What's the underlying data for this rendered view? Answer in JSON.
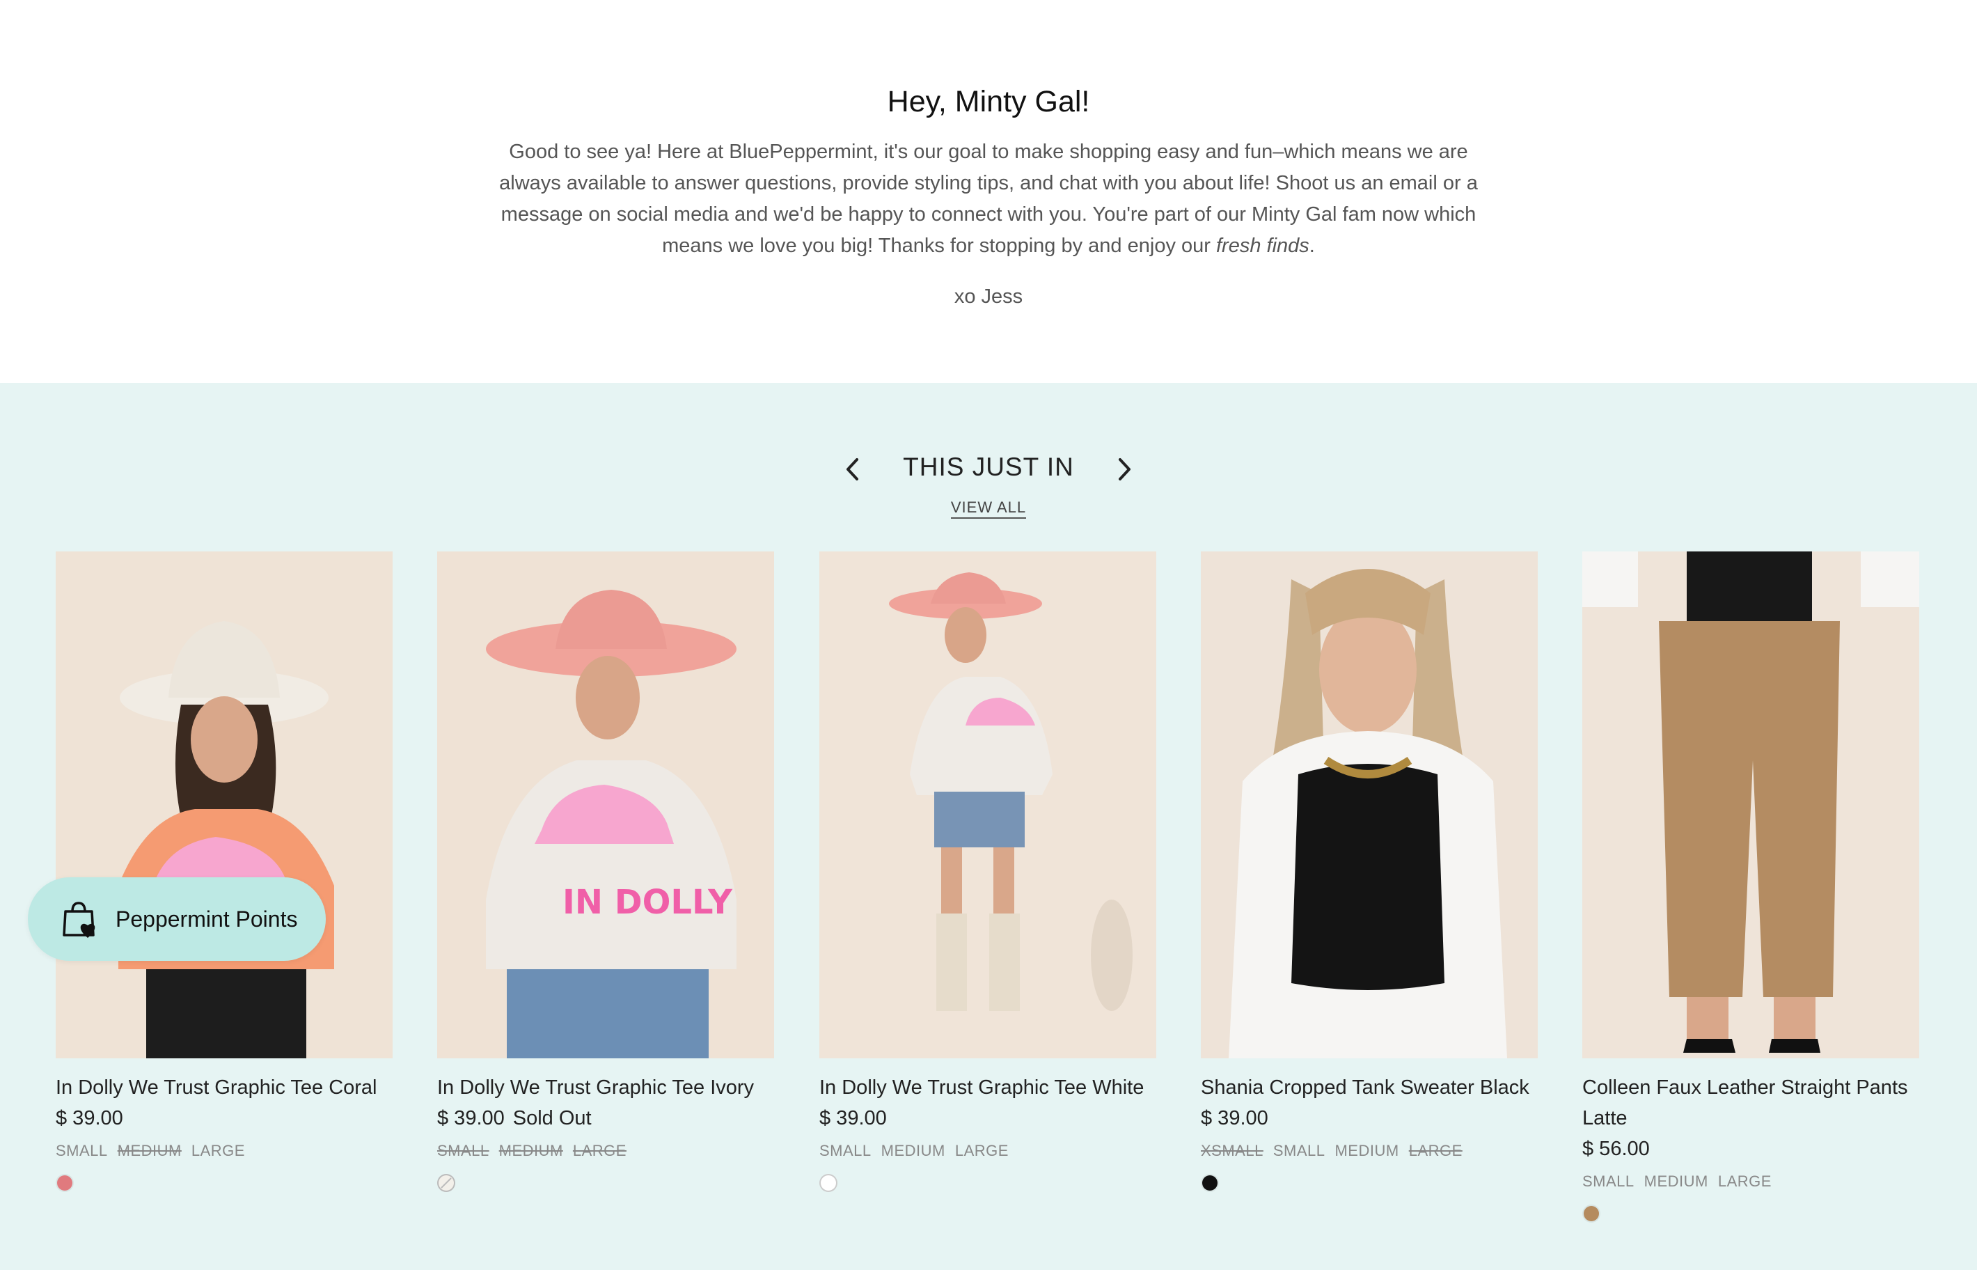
{
  "intro": {
    "heading": "Hey, Minty Gal!",
    "body": "Good to see ya! Here at BluePeppermint, it's our goal to make shopping easy and fun–which means we are always available to answer questions, provide styling tips, and chat with you about life! Shoot us an email or a message on social media and we'd be happy to connect with you. You're part of our Minty Gal fam now which means we love you big! Thanks for stopping by and enjoy our ",
    "emphasis": "fresh finds",
    "period": ".",
    "signature": "xo Jess"
  },
  "section": {
    "title": "THIS JUST IN",
    "view_all": "VIEW ALL"
  },
  "products": [
    {
      "title": "In Dolly We Trust Graphic Tee Coral",
      "price": "$ 39.00",
      "sold_out": "",
      "sizes": [
        {
          "label": "SMALL",
          "available": true
        },
        {
          "label": "MEDIUM",
          "available": false
        },
        {
          "label": "LARGE",
          "available": true
        }
      ],
      "swatch": "#e07a7e"
    },
    {
      "title": "In Dolly We Trust Graphic Tee Ivory",
      "price": "$ 39.00",
      "sold_out": "Sold Out",
      "sizes": [
        {
          "label": "SMALL",
          "available": false
        },
        {
          "label": "MEDIUM",
          "available": false
        },
        {
          "label": "LARGE",
          "available": false
        }
      ],
      "swatch": "#f3f0ea"
    },
    {
      "title": "In Dolly We Trust Graphic Tee White",
      "price": "$ 39.00",
      "sold_out": "",
      "sizes": [
        {
          "label": "SMALL",
          "available": true
        },
        {
          "label": "MEDIUM",
          "available": true
        },
        {
          "label": "LARGE",
          "available": true
        }
      ],
      "swatch": "#ffffff"
    },
    {
      "title": "Shania Cropped Tank Sweater Black",
      "price": "$ 39.00",
      "sold_out": "",
      "sizes": [
        {
          "label": "XSMALL",
          "available": false
        },
        {
          "label": "SMALL",
          "available": true
        },
        {
          "label": "MEDIUM",
          "available": true
        },
        {
          "label": "LARGE",
          "available": false
        }
      ],
      "swatch": "#111111"
    },
    {
      "title": "Colleen Faux Leather Straight Pants Latte",
      "price": "$ 56.00",
      "sold_out": "",
      "sizes": [
        {
          "label": "SMALL",
          "available": true
        },
        {
          "label": "MEDIUM",
          "available": true
        },
        {
          "label": "LARGE",
          "available": true
        }
      ],
      "swatch": "#b58b5e"
    }
  ],
  "points_widget": {
    "label": "Peppermint Points"
  },
  "colors": {
    "section_bg": "#e6f4f3",
    "widget_bg": "#bde9e4"
  }
}
